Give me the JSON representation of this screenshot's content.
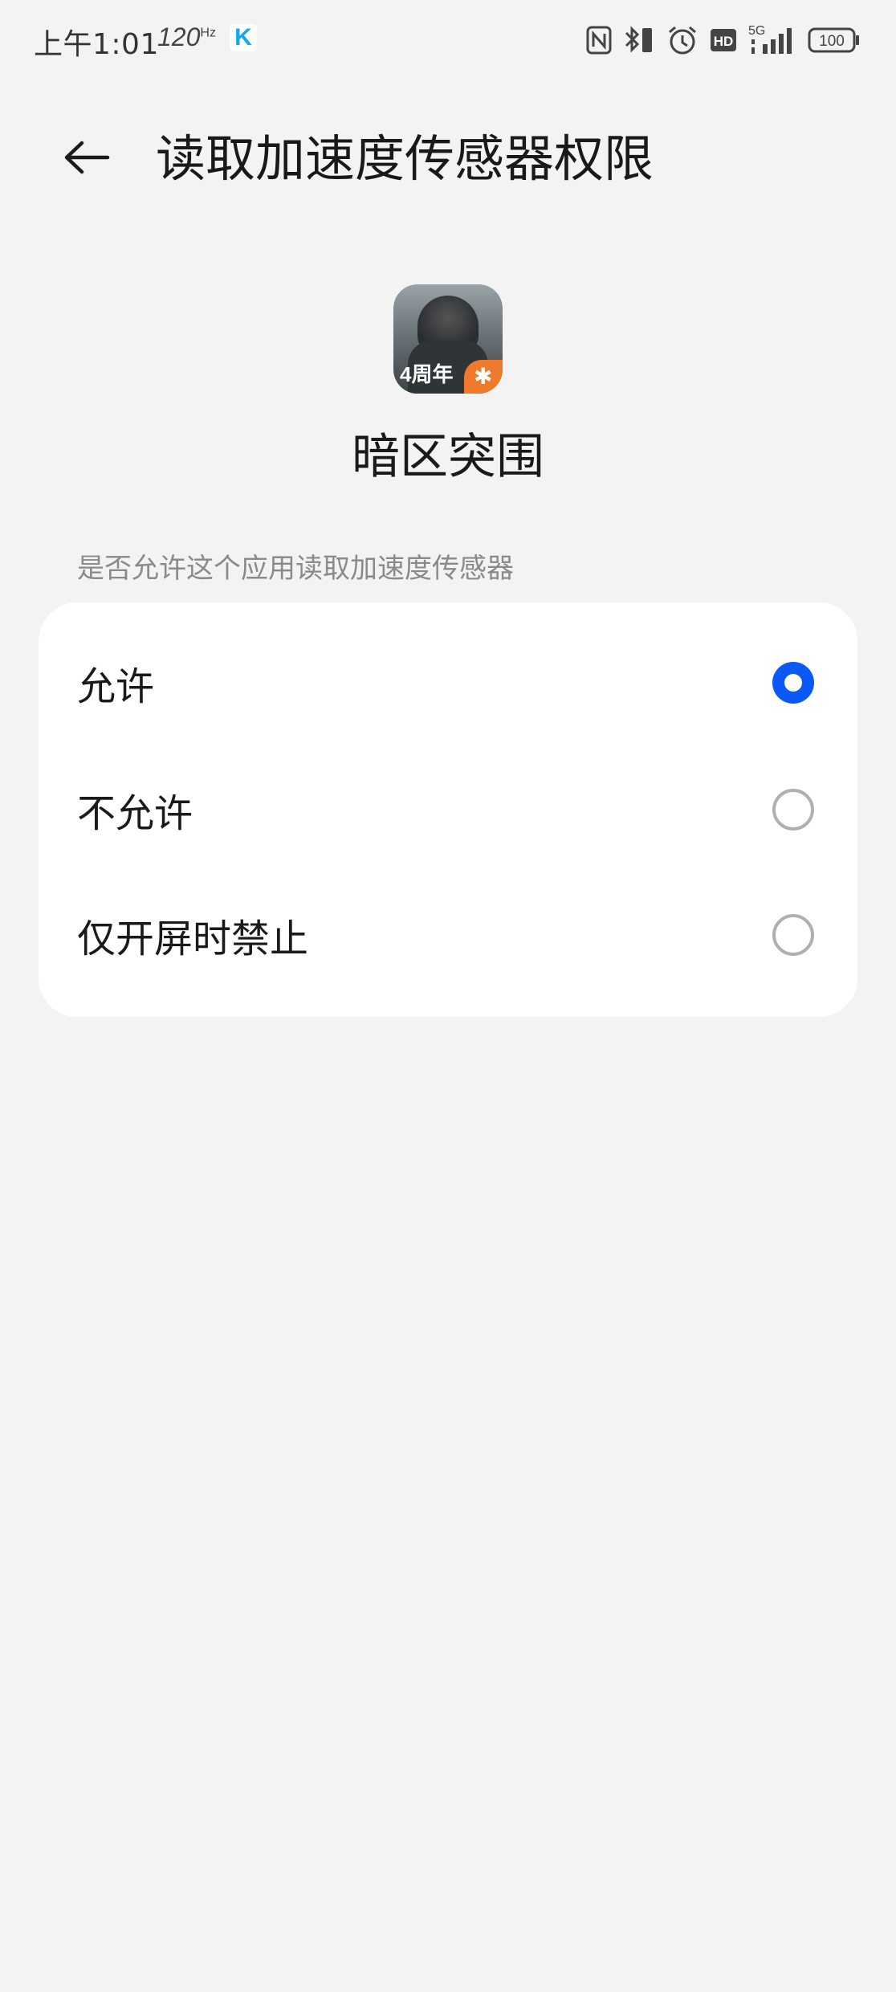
{
  "status_bar": {
    "time": "上午1:01",
    "refresh_rate": "120",
    "refresh_unit": "Hz",
    "app_badge": "K",
    "battery": "100",
    "network": "5G"
  },
  "header": {
    "title": "读取加速度传感器权限"
  },
  "app": {
    "name": "暗区突围",
    "icon_badge": "4周年"
  },
  "section": {
    "label": "是否允许这个应用读取加速度传感器"
  },
  "options": [
    {
      "label": "允许",
      "selected": true
    },
    {
      "label": "不允许",
      "selected": false
    },
    {
      "label": "仅开屏时禁止",
      "selected": false
    }
  ],
  "colors": {
    "accent": "#0a59f7",
    "background": "#f3f3f3",
    "card": "#ffffff"
  }
}
